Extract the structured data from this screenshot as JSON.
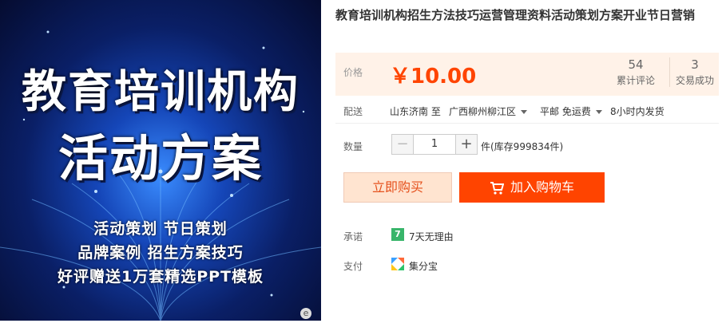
{
  "image": {
    "title_line1": "教育培训机构",
    "title_line2": "活动方案",
    "line1": "活动策划  节日策划",
    "line2": "品牌案例  招生方案技巧",
    "line3": "好评赠送1万套精选PPT模板",
    "zoom_label": "e"
  },
  "product": {
    "title": "教育培训机构招生方法技巧运营管理资料活动策划方案开业节日营销"
  },
  "price": {
    "label": "价格",
    "value": "￥10.00",
    "reviews_count": "54",
    "reviews_label": "累计评论",
    "deals_count": "3",
    "deals_label": "交易成功"
  },
  "shipping": {
    "label": "配送",
    "from": "山东济南 至",
    "to": "广西柳州柳江区",
    "method": "平邮 免运费",
    "dispatch": "8小时内发货"
  },
  "quantity": {
    "label": "数量",
    "minus": "−",
    "value": "1",
    "plus": "+",
    "stock": "件(库存999834件)"
  },
  "actions": {
    "buy_now": "立即购买",
    "add_to_cart": "加入购物车"
  },
  "promise": {
    "label": "承诺",
    "icon_text": "7",
    "text": "7天无理由"
  },
  "payment": {
    "label": "支付",
    "text": "集分宝"
  },
  "colors": {
    "price": "#ff4400",
    "cart_button": "#ff4400",
    "buy_button_bg": "#ffe4d0",
    "price_panel_bg": "#fff2e8"
  }
}
